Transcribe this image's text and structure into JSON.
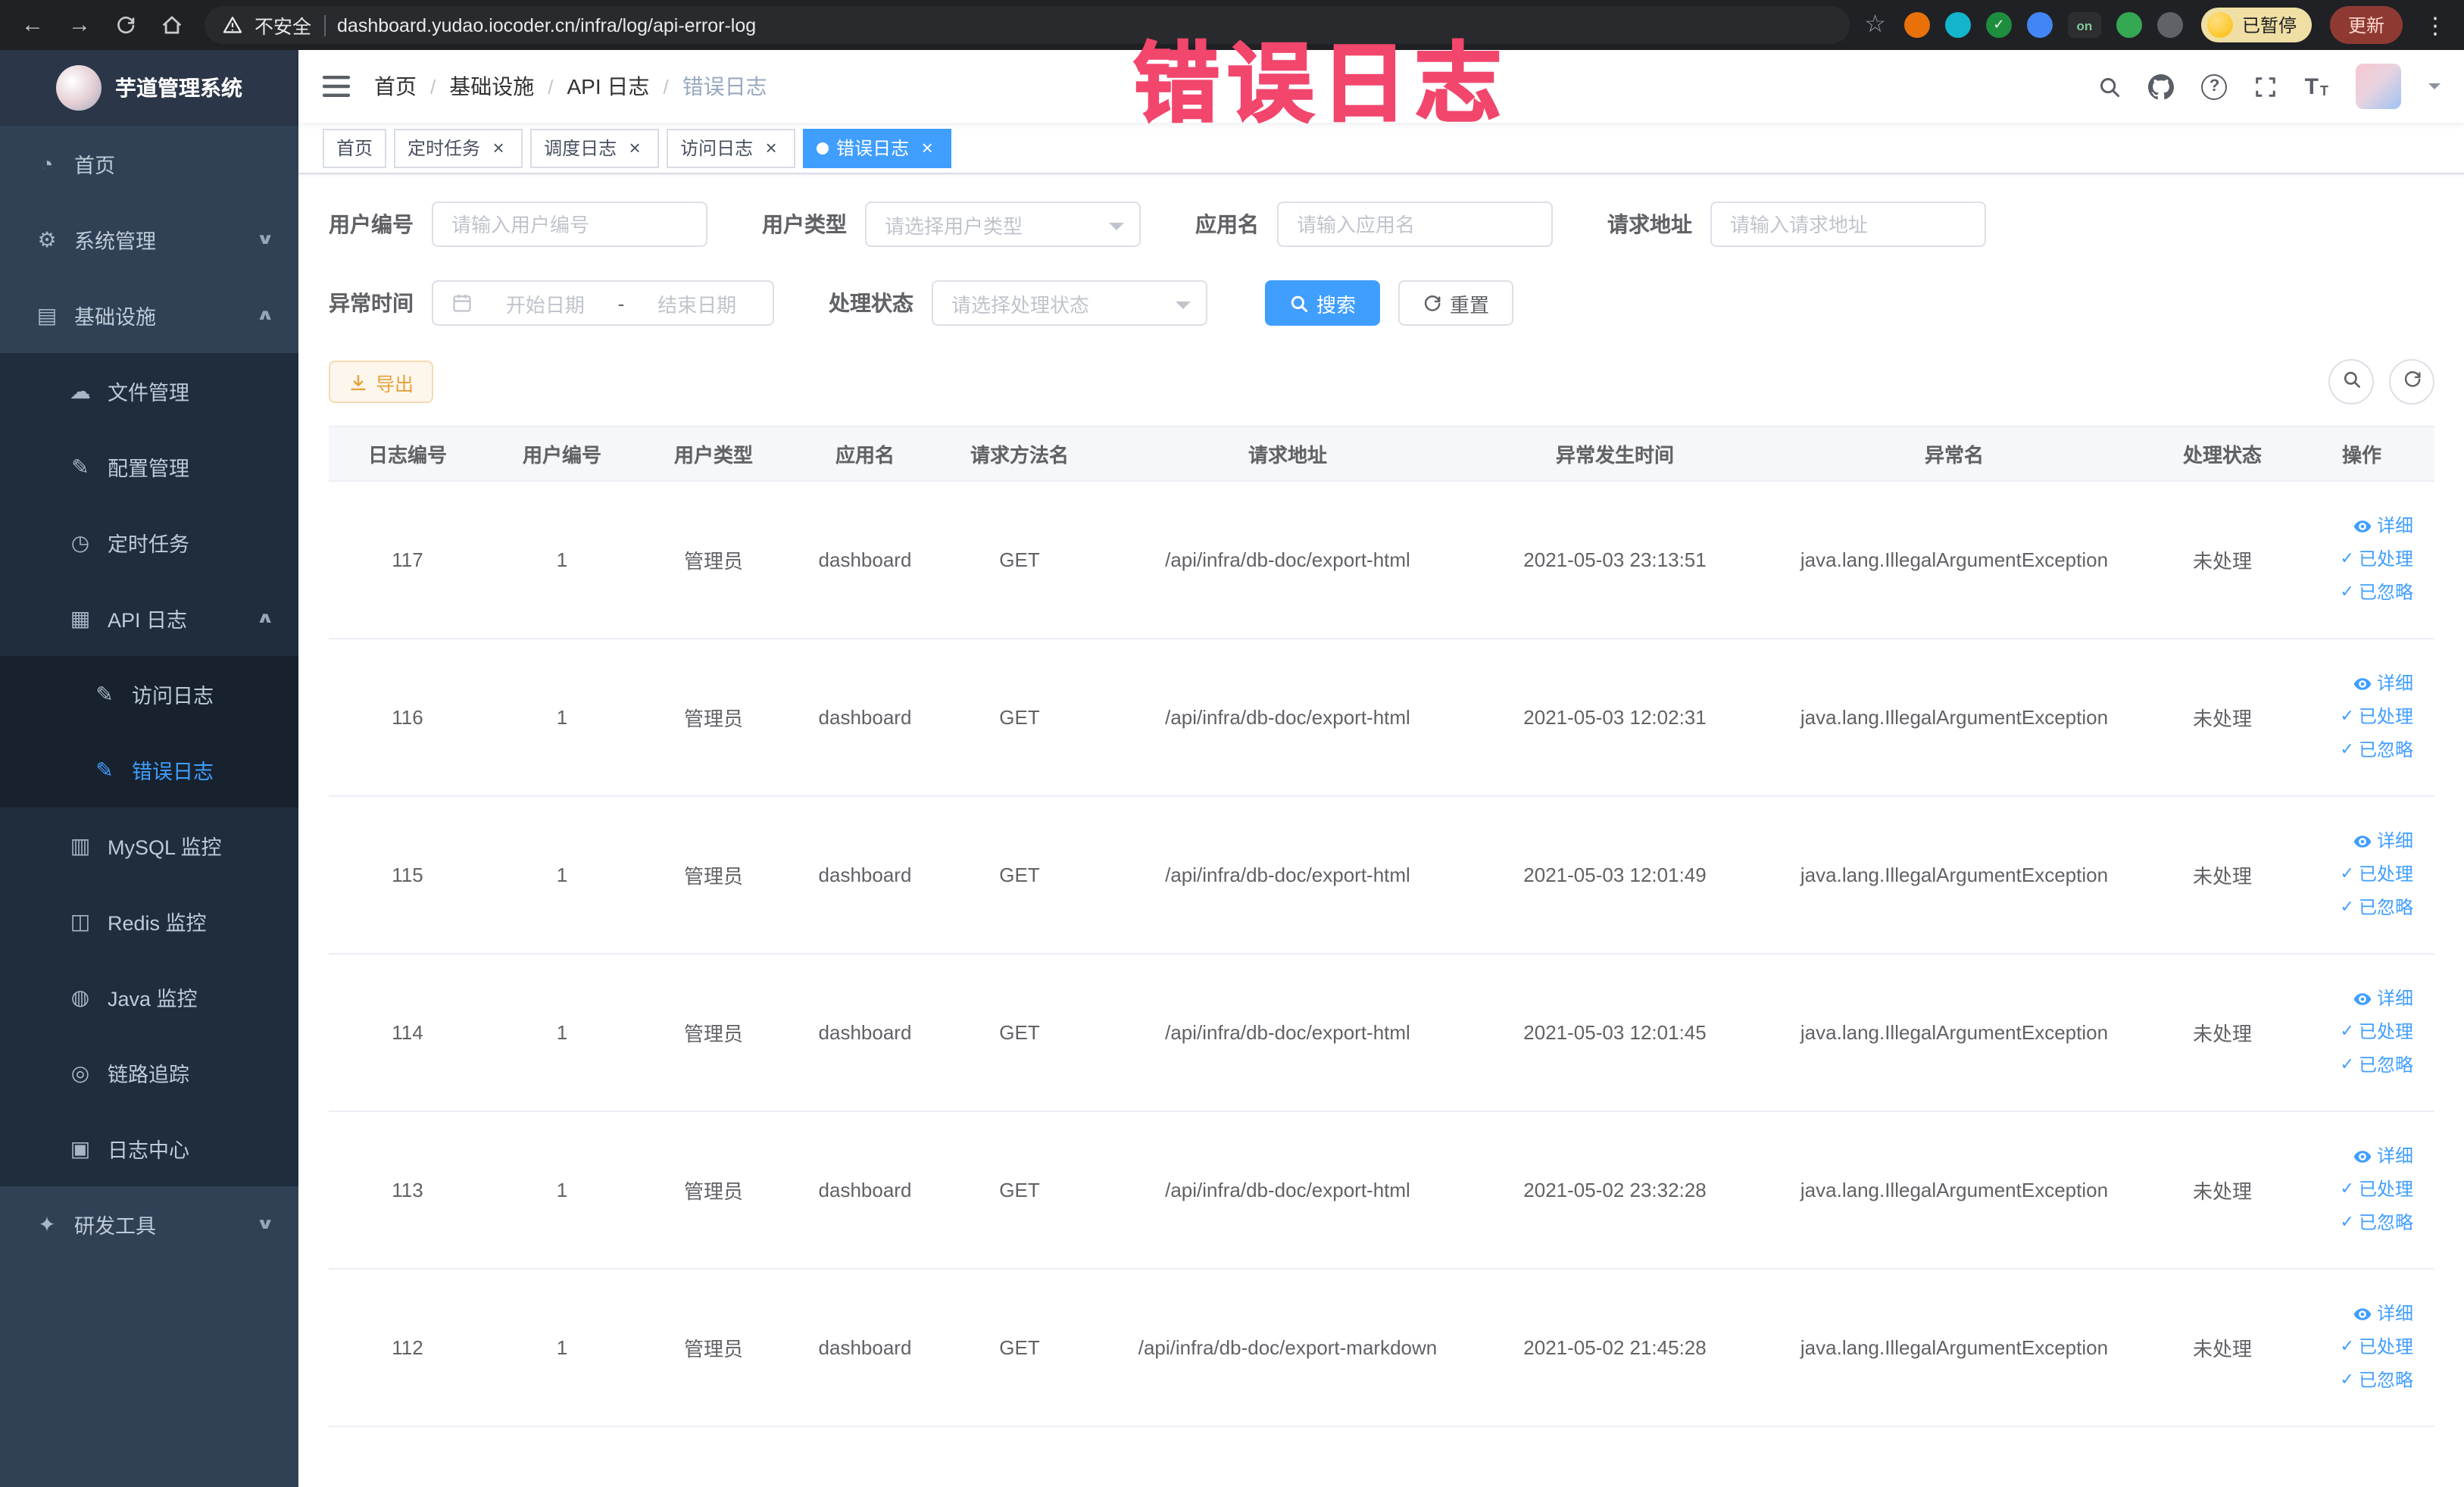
{
  "annotation": "错误日志",
  "browser": {
    "security_label": "不安全",
    "url": "dashboard.yudao.iocoder.cn/infra/log/api-error-log",
    "profile_badge": "已暂停",
    "update_label": "更新",
    "extensions": [
      {
        "id": "orange",
        "color": "#e8710a"
      },
      {
        "id": "teal-drop",
        "color": "#12b5cb"
      },
      {
        "id": "green-check",
        "color": "#1e8e3e",
        "glyph": "✓"
      },
      {
        "id": "blue-grid",
        "color": "#4285f4"
      },
      {
        "id": "on-badge",
        "color": "#2d2e31",
        "glyph": "on",
        "glyph_color": "#81c995"
      },
      {
        "id": "green-leaf",
        "color": "#34a853"
      },
      {
        "id": "dark-plugin",
        "color": "#5f6368"
      }
    ]
  },
  "sidebar": {
    "logo_title": "芋道管理系统",
    "items": [
      {
        "id": "home",
        "label": "首页",
        "icon": "dashboard-icon",
        "glyph": "◔",
        "level": 1
      },
      {
        "id": "system-management",
        "label": "系统管理",
        "icon": "gear-icon",
        "glyph": "⚙",
        "level": 1,
        "chevron": "down"
      },
      {
        "id": "infrastructure",
        "label": "基础设施",
        "icon": "infrastructure-icon",
        "glyph": "▤",
        "level": 1,
        "chevron": "up"
      },
      {
        "id": "file-management",
        "label": "文件管理",
        "icon": "cloud-icon",
        "glyph": "☁",
        "level": 2
      },
      {
        "id": "config-management",
        "label": "配置管理",
        "icon": "edit-icon",
        "glyph": "✎",
        "level": 2
      },
      {
        "id": "scheduled-tasks",
        "label": "定时任务",
        "icon": "clock-icon",
        "glyph": "◷",
        "level": 2
      },
      {
        "id": "api-log",
        "label": "API 日志",
        "icon": "api-log-icon",
        "glyph": "▦",
        "level": 2,
        "chevron": "up"
      },
      {
        "id": "access-log",
        "label": "访问日志",
        "icon": "access-log-icon",
        "glyph": "✎",
        "level": 3
      },
      {
        "id": "error-log",
        "label": "错误日志",
        "icon": "error-log-icon",
        "glyph": "✎",
        "level": 3,
        "active": true
      },
      {
        "id": "mysql-monitor",
        "label": "MySQL 监控",
        "icon": "mysql-icon",
        "glyph": "▥",
        "level": 2
      },
      {
        "id": "redis-monitor",
        "label": "Redis 监控",
        "icon": "redis-icon",
        "glyph": "◫",
        "level": 2
      },
      {
        "id": "java-monitor",
        "label": "Java 监控",
        "icon": "java-icon",
        "glyph": "◍",
        "level": 2
      },
      {
        "id": "link-tracing",
        "label": "链路追踪",
        "icon": "trace-icon",
        "glyph": "◎",
        "level": 2
      },
      {
        "id": "log-center",
        "label": "日志中心",
        "icon": "log-center-icon",
        "glyph": "▣",
        "level": 2
      },
      {
        "id": "dev-tools",
        "label": "研发工具",
        "icon": "tools-icon",
        "glyph": "✦",
        "level": 1,
        "chevron": "down"
      }
    ]
  },
  "header": {
    "breadcrumb": [
      "首页",
      "基础设施",
      "API 日志",
      "错误日志"
    ]
  },
  "tabs": [
    {
      "id": "home",
      "label": "首页",
      "closable": false,
      "active": false
    },
    {
      "id": "scheduled-tasks",
      "label": "定时任务",
      "closable": true,
      "active": false
    },
    {
      "id": "schedule-log",
      "label": "调度日志",
      "closable": true,
      "active": false
    },
    {
      "id": "access-log",
      "label": "访问日志",
      "closable": true,
      "active": false
    },
    {
      "id": "error-log",
      "label": "错误日志",
      "closable": true,
      "active": true
    }
  ],
  "filters": {
    "user_id": {
      "label": "用户编号",
      "placeholder": "请输入用户编号"
    },
    "user_type": {
      "label": "用户类型",
      "placeholder": "请选择用户类型"
    },
    "app_name": {
      "label": "应用名",
      "placeholder": "请输入应用名"
    },
    "request_url": {
      "label": "请求地址",
      "placeholder": "请输入请求地址"
    },
    "exception_time": {
      "label": "异常时间",
      "start_placeholder": "开始日期",
      "separator": "-",
      "end_placeholder": "结束日期"
    },
    "process_status": {
      "label": "处理状态",
      "placeholder": "请选择处理状态"
    },
    "search_label": "搜索",
    "reset_label": "重置"
  },
  "toolbar": {
    "export_label": "导出"
  },
  "table": {
    "columns": [
      "日志编号",
      "用户编号",
      "用户类型",
      "应用名",
      "请求方法名",
      "请求地址",
      "异常发生时间",
      "异常名",
      "处理状态",
      "操作"
    ],
    "actions": [
      {
        "id": "detail",
        "label": "详细",
        "icon": "eye"
      },
      {
        "id": "processed",
        "label": "已处理",
        "icon": "check"
      },
      {
        "id": "ignored",
        "label": "已忽略",
        "icon": "check"
      }
    ],
    "rows": [
      {
        "id": "117",
        "user_id": "1",
        "user_type": "管理员",
        "app_name": "dashboard",
        "method": "GET",
        "url": "/api/infra/db-doc/export-html",
        "time": "2021-05-03 23:13:51",
        "exception": "java.lang.IllegalArgumentException",
        "status": "未处理"
      },
      {
        "id": "116",
        "user_id": "1",
        "user_type": "管理员",
        "app_name": "dashboard",
        "method": "GET",
        "url": "/api/infra/db-doc/export-html",
        "time": "2021-05-03 12:02:31",
        "exception": "java.lang.IllegalArgumentException",
        "status": "未处理"
      },
      {
        "id": "115",
        "user_id": "1",
        "user_type": "管理员",
        "app_name": "dashboard",
        "method": "GET",
        "url": "/api/infra/db-doc/export-html",
        "time": "2021-05-03 12:01:49",
        "exception": "java.lang.IllegalArgumentException",
        "status": "未处理"
      },
      {
        "id": "114",
        "user_id": "1",
        "user_type": "管理员",
        "app_name": "dashboard",
        "method": "GET",
        "url": "/api/infra/db-doc/export-html",
        "time": "2021-05-03 12:01:45",
        "exception": "java.lang.IllegalArgumentException",
        "status": "未处理"
      },
      {
        "id": "113",
        "user_id": "1",
        "user_type": "管理员",
        "app_name": "dashboard",
        "method": "GET",
        "url": "/api/infra/db-doc/export-html",
        "time": "2021-05-02 23:32:28",
        "exception": "java.lang.IllegalArgumentException",
        "status": "未处理"
      },
      {
        "id": "112",
        "user_id": "1",
        "user_type": "管理员",
        "app_name": "dashboard",
        "method": "GET",
        "url": "/api/infra/db-doc/export-markdown",
        "time": "2021-05-02 21:45:28",
        "exception": "java.lang.IllegalArgumentException",
        "status": "未处理"
      }
    ]
  },
  "colors": {
    "accent": "#409eff",
    "warning": "#e6a23c",
    "sidebar_bg": "#304156",
    "annotation_pink": "#f2466d"
  }
}
